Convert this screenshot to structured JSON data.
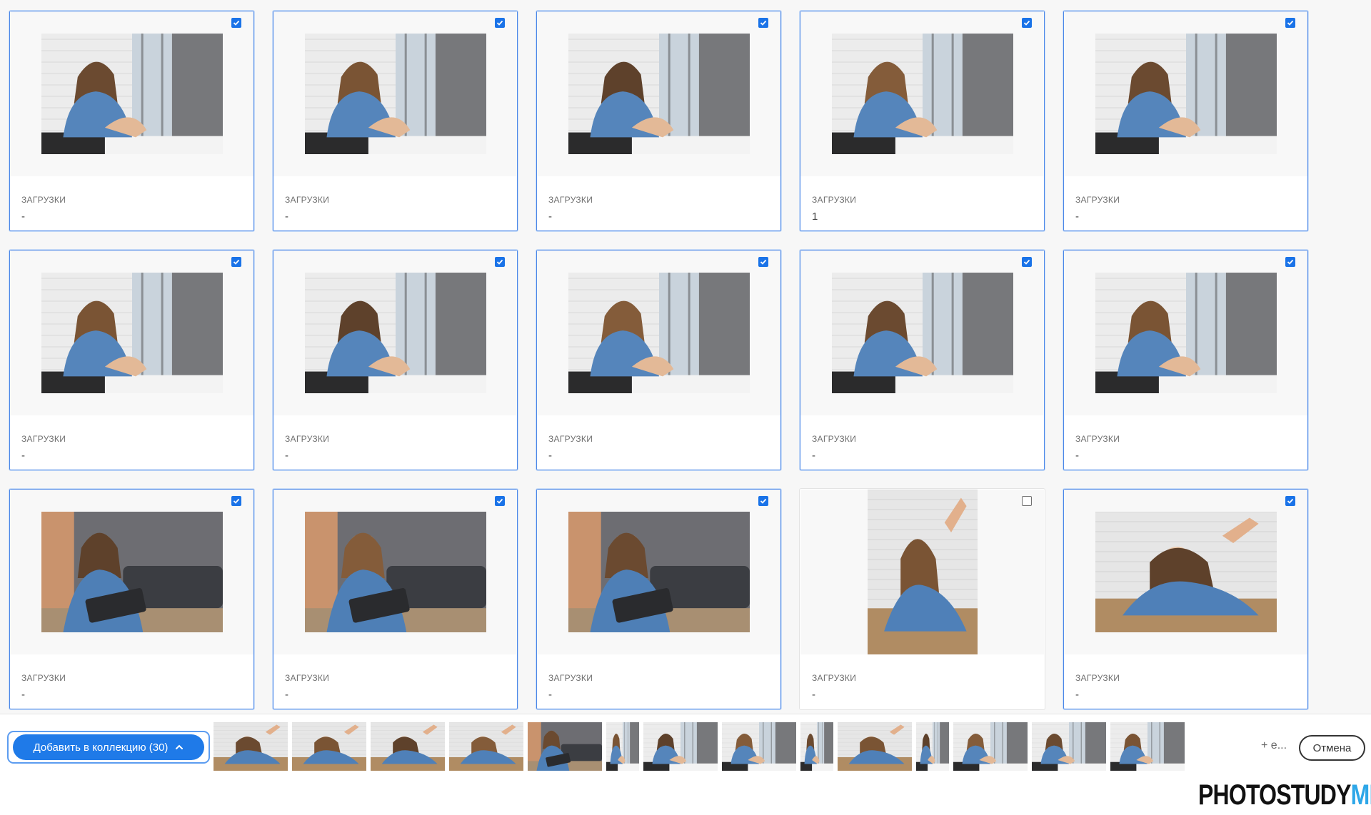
{
  "colors": {
    "accent": "#1f7ae8",
    "selected_border": "#4b87e8",
    "logo_dark": "#111111",
    "logo_blue": "#2ea7e8"
  },
  "grid": {
    "label_text": "ЗАГРУЗКИ",
    "cards": [
      {
        "downloads": "-",
        "selected": true,
        "scene": "window-sit-phone"
      },
      {
        "downloads": "-",
        "selected": true,
        "scene": "window-headphones"
      },
      {
        "downloads": "-",
        "selected": true,
        "scene": "window-headphones-mug"
      },
      {
        "downloads": "1",
        "selected": true,
        "scene": "window-knees-phone"
      },
      {
        "downloads": "-",
        "selected": true,
        "scene": "window-headphones-phone"
      },
      {
        "downloads": "-",
        "selected": true,
        "scene": "window-hug-knees"
      },
      {
        "downloads": "-",
        "selected": true,
        "scene": "window-head-down"
      },
      {
        "downloads": "-",
        "selected": true,
        "scene": "window-cross-legged-mug"
      },
      {
        "downloads": "-",
        "selected": true,
        "scene": "window-lean-mug"
      },
      {
        "downloads": "-",
        "selected": true,
        "scene": "window-laptop-smile"
      },
      {
        "downloads": "-",
        "selected": true,
        "scene": "sofa-laptop"
      },
      {
        "downloads": "-",
        "selected": true,
        "scene": "sofa-phone-friend"
      },
      {
        "downloads": "-",
        "selected": true,
        "scene": "sofa-laptop-think"
      },
      {
        "downloads": "-",
        "selected": false,
        "scene": "floor-lying-portrait"
      },
      {
        "downloads": "-",
        "selected": true,
        "scene": "floor-laptop-mug"
      }
    ]
  },
  "bottom_bar": {
    "add_button_label": "Добавить в коллекцию (30)",
    "more_label": "+ е...",
    "cancel_label": "Отмена",
    "strip_count": 14
  },
  "logo": {
    "part1": "PHOTOSTUDY",
    "part2": "ME"
  }
}
